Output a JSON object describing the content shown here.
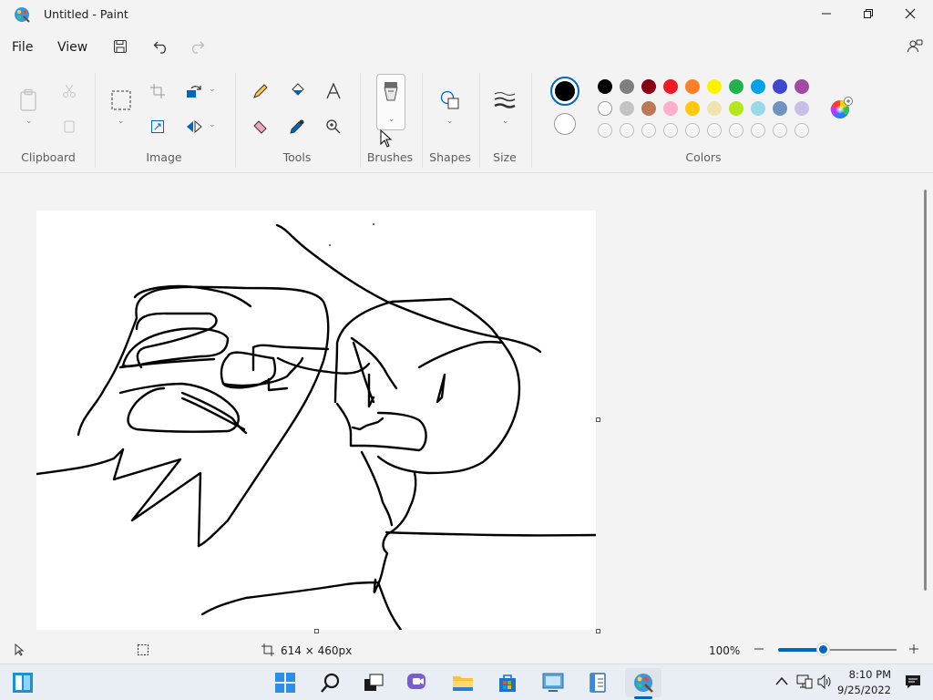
{
  "window": {
    "title": "Untitled - Paint",
    "controls": [
      "minimize",
      "maximize",
      "close"
    ]
  },
  "menu": {
    "file_label": "File",
    "view_label": "View",
    "quick_actions": [
      "save-icon",
      "undo-icon",
      "redo-icon"
    ]
  },
  "ribbon": {
    "groups": {
      "clipboard": "Clipboard",
      "image": "Image",
      "tools": "Tools",
      "brushes": "Brushes",
      "shapes": "Shapes",
      "size": "Size",
      "colors": "Colors"
    },
    "colors": {
      "color1": "#000000",
      "color2": "#ffffff",
      "palette_row1": [
        "#000000",
        "#7f7f7f",
        "#880015",
        "#ed1c24",
        "#ff7f27",
        "#fff200",
        "#22b14c",
        "#00a2e8",
        "#3f48cc",
        "#a349a4"
      ],
      "palette_row2": [
        "#ffffff",
        "#c3c3c3",
        "#b97a57",
        "#ffaec9",
        "#ffc90e",
        "#efe4b0",
        "#b5e61d",
        "#99d9ea",
        "#7092be",
        "#c8bfe7"
      ],
      "palette_row3_empty_slots": 10
    }
  },
  "statusbar": {
    "canvas_size": "614 × 460px",
    "zoom": "100%",
    "zoom_level_percent": 100
  },
  "taskbar": {
    "apps": [
      "widgets-icon",
      "start-icon",
      "search-icon",
      "task-view-icon",
      "chat-icon",
      "file-explorer-icon",
      "store-icon",
      "control-panel-icon",
      "notepad-icon",
      "paint-icon"
    ],
    "time": "8:10 PM",
    "date": "9/25/2022"
  },
  "colors": {
    "accent": "#0067c0",
    "background": "#f3f3f3"
  }
}
